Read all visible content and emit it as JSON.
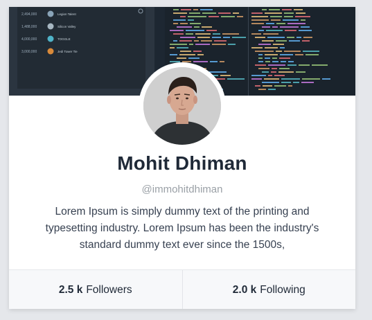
{
  "profile": {
    "name": "Mohit Dhiman",
    "handle": "@immohitdhiman",
    "bio": "Lorem Ipsum is simply dummy text of the printing and typesetting industry. Lorem Ipsum has been the industry's standard dummy text ever since the 1500s,"
  },
  "stats": [
    {
      "count": "2.5 k",
      "label": "Followers"
    },
    {
      "count": "2.0 k",
      "label": "Following"
    }
  ],
  "cover_text": {
    "counts": [
      "2,494,000",
      "1,488,000",
      "4,000,000",
      "3,000,000"
    ],
    "names": [
      "Legion Talent",
      "Silicon Valley",
      "TOGGLE",
      "Jedi Tower Tie"
    ]
  },
  "colors": {
    "name": "#1f2937",
    "handle": "#9aa0a6",
    "bio": "#374151",
    "stats_bg": "#f7f8fa",
    "cover_bg": "#1f2a33"
  }
}
